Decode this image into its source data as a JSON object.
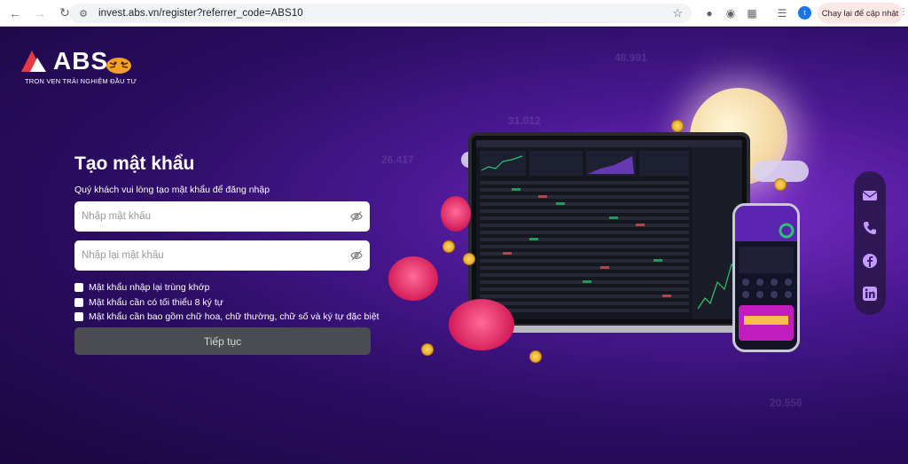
{
  "browser": {
    "url": "invest.abs.vn/register?referrer_code=ABS10",
    "update_label": "Chạy lại để cập nhật",
    "profile_initial": "t"
  },
  "brand": {
    "logo": "ABS",
    "tagline": "TRỌN VẸN TRẢI NGHIỆM ĐẦU TƯ"
  },
  "form": {
    "title": "Tạo mật khẩu",
    "subtitle": "Quý khách vui lòng tạo mật khẩu để đăng nhập",
    "password_placeholder": "Nhập mật khẩu",
    "confirm_placeholder": "Nhập lại mật khẩu",
    "rules": [
      "Mật khẩu nhập lại trùng khớp",
      "Mật khẩu cần có tối thiểu 8 ký tự",
      "Mật khẩu cần bao gồm chữ hoa, chữ thường, chữ số và ký tự đặc biệt"
    ],
    "submit_label": "Tiếp tục"
  },
  "background_numbers": [
    "48.991",
    "31.012",
    "26.417",
    "20.556"
  ],
  "social": [
    "mail-icon",
    "phone-icon",
    "facebook-icon",
    "linkedin-icon"
  ],
  "colors": {
    "accent_purple": "#4a1892",
    "button_disabled": "#4b4b52"
  }
}
